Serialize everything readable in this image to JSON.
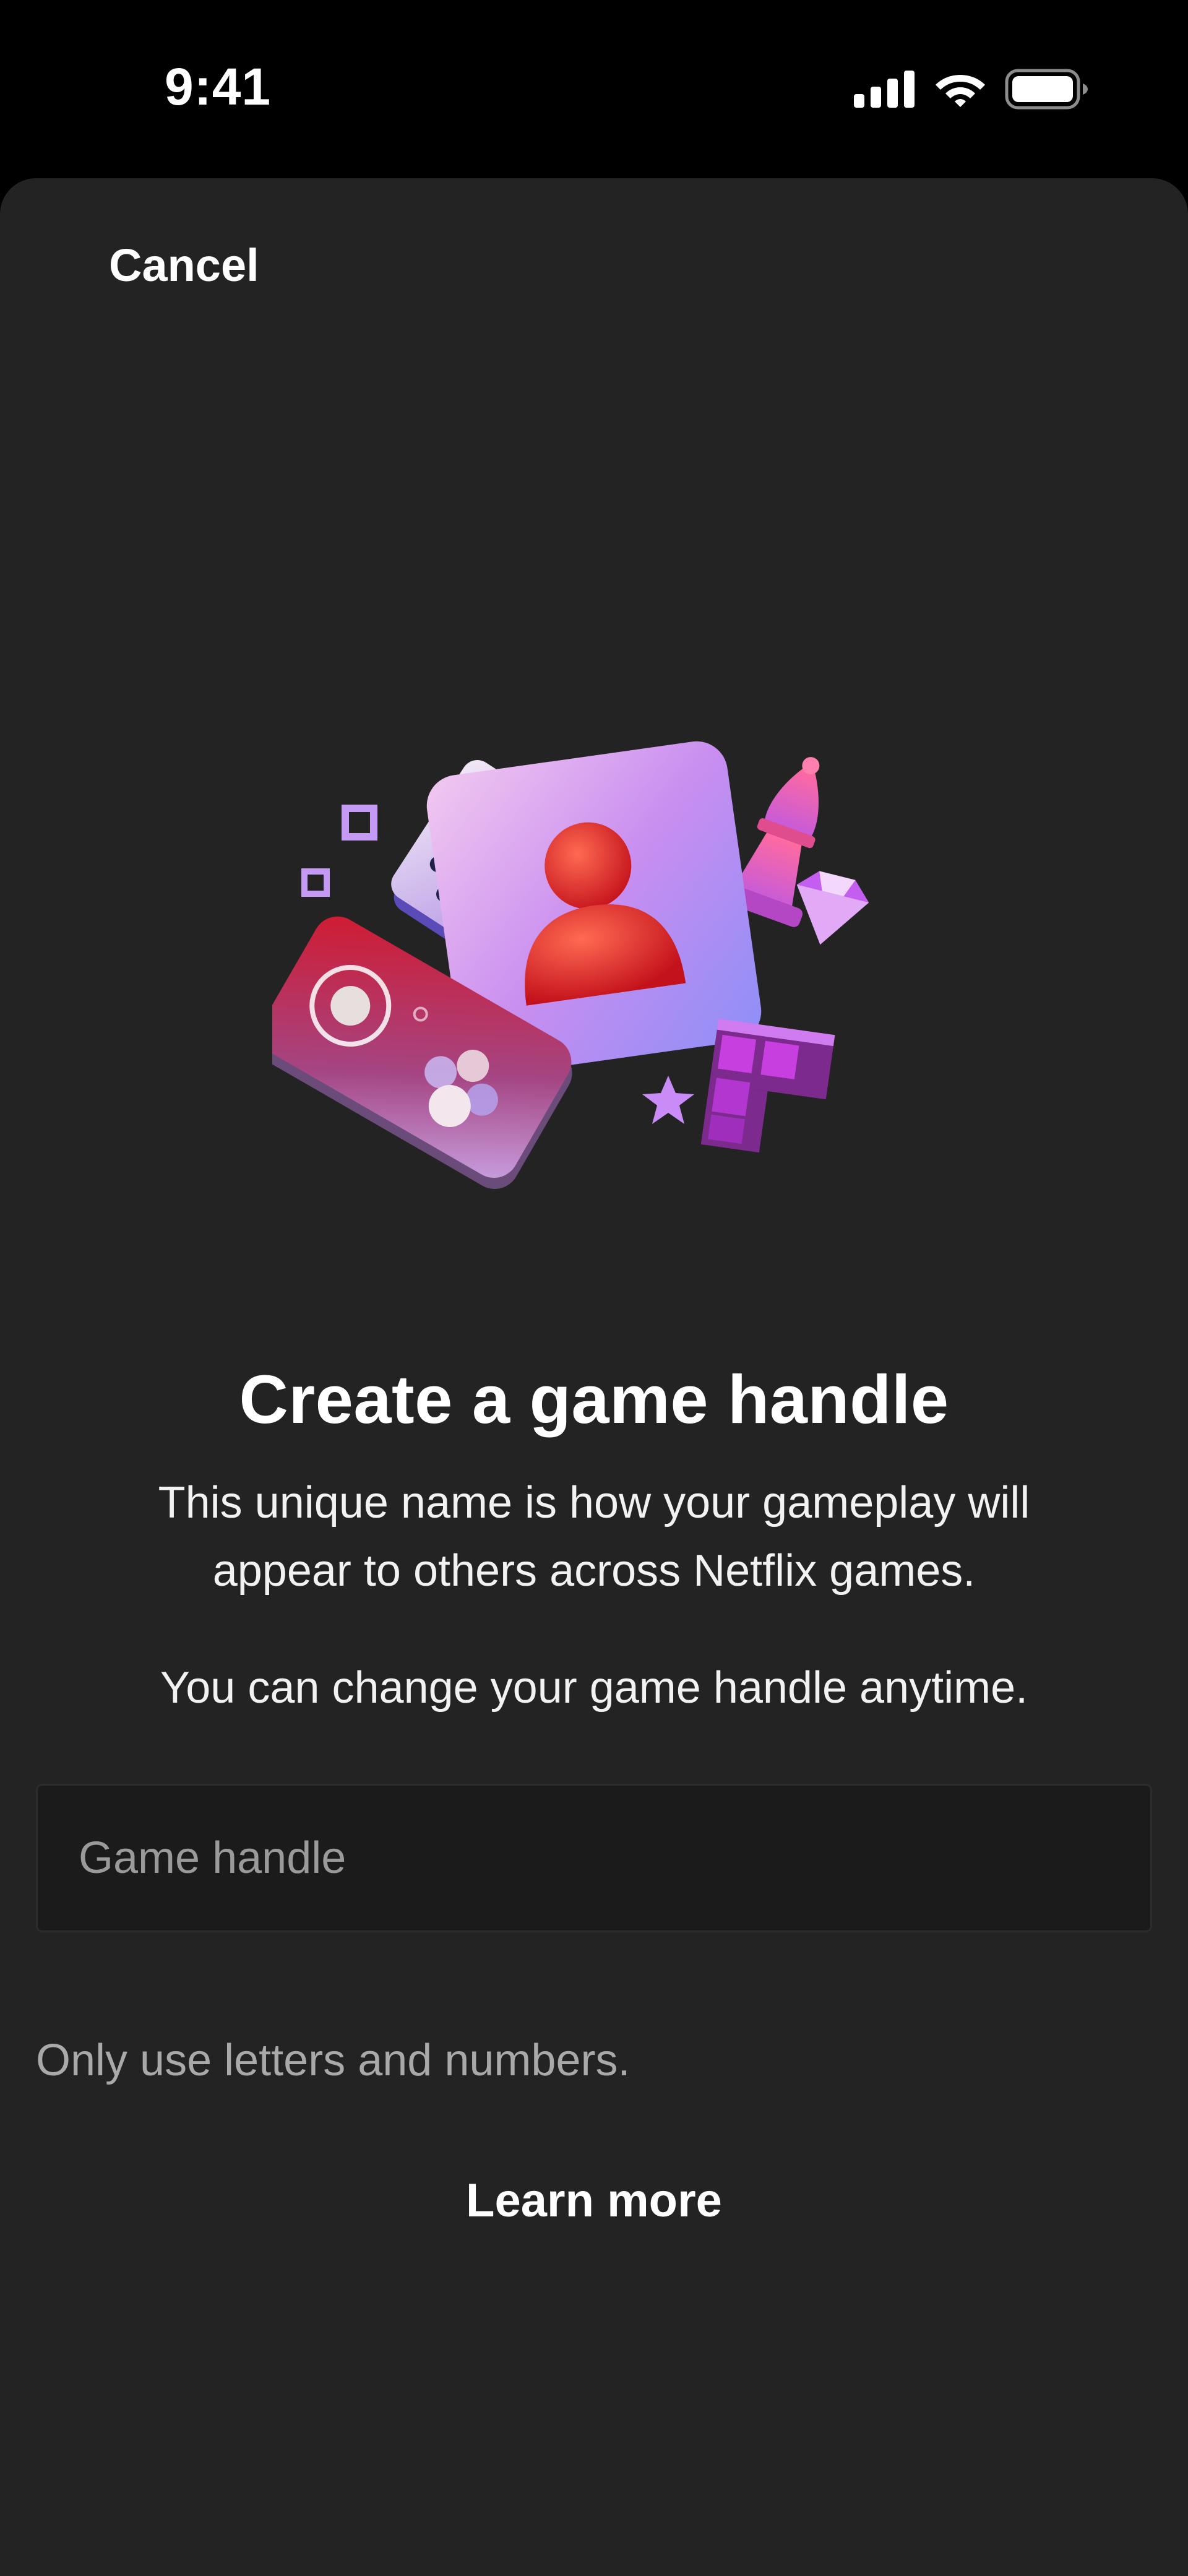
{
  "status_bar": {
    "time": "9:41",
    "icons": [
      "signal-icon",
      "wifi-icon",
      "battery-icon"
    ]
  },
  "header": {
    "cancel_label": "Cancel"
  },
  "hero": {
    "illustration": "game-handle-illustration"
  },
  "main": {
    "title": "Create a game handle",
    "description": "This unique name is how your gameplay will appear to others across Netflix games.",
    "description_secondary": "You can change your game handle anytime."
  },
  "form": {
    "handle_input": {
      "value": "",
      "placeholder": "Game handle"
    },
    "hint": "Only use letters and numbers."
  },
  "footer": {
    "learn_more_label": "Learn more"
  },
  "colors": {
    "sheet_background": "#232323",
    "status_background": "#000000",
    "input_background": "#1b1b1b",
    "hint_text": "#a9a9a9",
    "accent_red": "#e8262e",
    "accent_purple": "#b455e6"
  }
}
